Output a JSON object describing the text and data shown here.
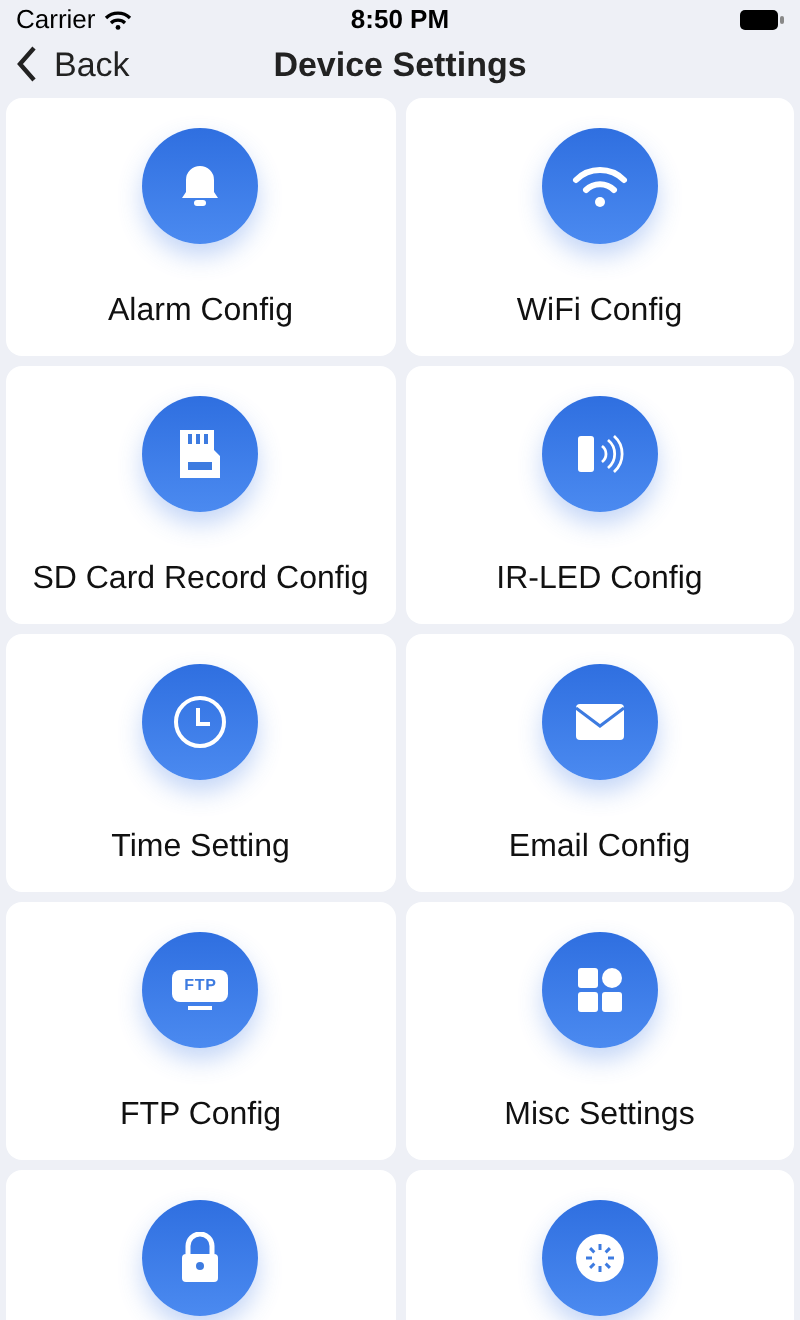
{
  "status_bar": {
    "carrier": "Carrier",
    "time": "8:50 PM"
  },
  "nav": {
    "back": "Back",
    "title": "Device Settings"
  },
  "items": [
    {
      "kind": "bell",
      "label": "Alarm Config"
    },
    {
      "kind": "wifi",
      "label": "WiFi Config"
    },
    {
      "kind": "sdcard",
      "label": "SD Card Record Config"
    },
    {
      "kind": "irled",
      "label": "IR-LED Config"
    },
    {
      "kind": "clock",
      "label": "Time Setting"
    },
    {
      "kind": "mail",
      "label": "Email Config"
    },
    {
      "kind": "ftp",
      "icon_text": "FTP",
      "label": "FTP Config"
    },
    {
      "kind": "tiles",
      "label": "Misc Settings"
    },
    {
      "kind": "lock"
    },
    {
      "kind": "reset"
    }
  ]
}
